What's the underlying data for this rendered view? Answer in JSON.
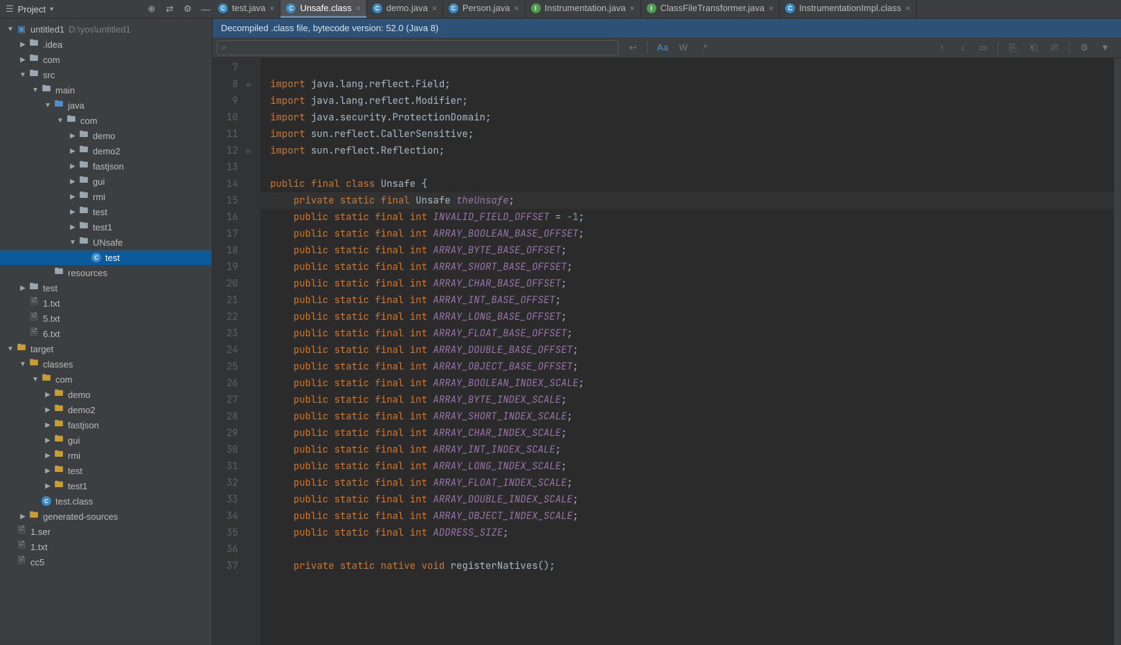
{
  "projectHeader": {
    "title": "Project",
    "dropdownGlyph": "▾",
    "tool1": "⊕",
    "tool2": "⇄",
    "tool3": "⚙",
    "tool4": "—"
  },
  "tabs": [
    {
      "icon": "C",
      "type": "c",
      "label": "test.java",
      "active": false
    },
    {
      "icon": "C",
      "type": "c",
      "label": "Unsafe.class",
      "active": true
    },
    {
      "icon": "C",
      "type": "c",
      "label": "demo.java",
      "active": false
    },
    {
      "icon": "C",
      "type": "c",
      "label": "Person.java",
      "active": false
    },
    {
      "icon": "I",
      "type": "i",
      "label": "Instrumentation.java",
      "active": false
    },
    {
      "icon": "I",
      "type": "i",
      "label": "ClassFileTransformer.java",
      "active": false
    },
    {
      "icon": "C",
      "type": "c",
      "label": "InstrumentationImpl.class",
      "active": false
    }
  ],
  "tree": [
    {
      "indent": 0,
      "arrow": "▼",
      "iconClass": "module-icon",
      "iconGlyph": "▣",
      "label": "untitled1",
      "dim": "D:\\yos\\untitled1"
    },
    {
      "indent": 1,
      "arrow": "▶",
      "iconClass": "folder-icon",
      "iconGlyph": "🖿",
      "label": ".idea"
    },
    {
      "indent": 1,
      "arrow": "▶",
      "iconClass": "folder-icon",
      "iconGlyph": "🖿",
      "label": "com"
    },
    {
      "indent": 1,
      "arrow": "▼",
      "iconClass": "folder-icon",
      "iconGlyph": "🖿",
      "label": "src"
    },
    {
      "indent": 2,
      "arrow": "▼",
      "iconClass": "folder-icon",
      "iconGlyph": "🖿",
      "label": "main"
    },
    {
      "indent": 3,
      "arrow": "▼",
      "iconClass": "folder-blue",
      "iconGlyph": "🖿",
      "label": "java"
    },
    {
      "indent": 4,
      "arrow": "▼",
      "iconClass": "folder-icon",
      "iconGlyph": "🖿",
      "label": "com"
    },
    {
      "indent": 5,
      "arrow": "▶",
      "iconClass": "folder-icon",
      "iconGlyph": "🖿",
      "label": "demo"
    },
    {
      "indent": 5,
      "arrow": "▶",
      "iconClass": "folder-icon",
      "iconGlyph": "🖿",
      "label": "demo2"
    },
    {
      "indent": 5,
      "arrow": "▶",
      "iconClass": "folder-icon",
      "iconGlyph": "🖿",
      "label": "fastjson"
    },
    {
      "indent": 5,
      "arrow": "▶",
      "iconClass": "folder-icon",
      "iconGlyph": "🖿",
      "label": "gui"
    },
    {
      "indent": 5,
      "arrow": "▶",
      "iconClass": "folder-icon",
      "iconGlyph": "🖿",
      "label": "rmi"
    },
    {
      "indent": 5,
      "arrow": "▶",
      "iconClass": "folder-icon",
      "iconGlyph": "🖿",
      "label": "test"
    },
    {
      "indent": 5,
      "arrow": "▶",
      "iconClass": "folder-icon",
      "iconGlyph": "🖿",
      "label": "test1"
    },
    {
      "indent": 5,
      "arrow": "▼",
      "iconClass": "folder-icon",
      "iconGlyph": "🖿",
      "label": "UNsafe"
    },
    {
      "indent": 6,
      "arrow": "",
      "iconType": "class",
      "iconGlyph": "C",
      "label": "test",
      "selected": true
    },
    {
      "indent": 3,
      "arrow": "",
      "iconClass": "folder-icon",
      "iconGlyph": "🖿",
      "label": "resources"
    },
    {
      "indent": 1,
      "arrow": "▶",
      "iconClass": "folder-icon",
      "iconGlyph": "🖿",
      "label": "test"
    },
    {
      "indent": 1,
      "arrow": "",
      "iconClass": "file-icon",
      "iconGlyph": "🗎",
      "label": "1.txt"
    },
    {
      "indent": 1,
      "arrow": "",
      "iconClass": "file-icon",
      "iconGlyph": "🗎",
      "label": "5.txt"
    },
    {
      "indent": 1,
      "arrow": "",
      "iconClass": "file-icon",
      "iconGlyph": "🗎",
      "label": "6.txt"
    },
    {
      "indent": 0,
      "arrow": "▼",
      "iconClass": "folder-gold",
      "iconGlyph": "🖿",
      "label": "target"
    },
    {
      "indent": 1,
      "arrow": "▼",
      "iconClass": "folder-gold",
      "iconGlyph": "🖿",
      "label": "classes"
    },
    {
      "indent": 2,
      "arrow": "▼",
      "iconClass": "folder-gold",
      "iconGlyph": "🖿",
      "label": "com"
    },
    {
      "indent": 3,
      "arrow": "▶",
      "iconClass": "folder-gold",
      "iconGlyph": "🖿",
      "label": "demo"
    },
    {
      "indent": 3,
      "arrow": "▶",
      "iconClass": "folder-gold",
      "iconGlyph": "🖿",
      "label": "demo2"
    },
    {
      "indent": 3,
      "arrow": "▶",
      "iconClass": "folder-gold",
      "iconGlyph": "🖿",
      "label": "fastjson"
    },
    {
      "indent": 3,
      "arrow": "▶",
      "iconClass": "folder-gold",
      "iconGlyph": "🖿",
      "label": "gui"
    },
    {
      "indent": 3,
      "arrow": "▶",
      "iconClass": "folder-gold",
      "iconGlyph": "🖿",
      "label": "rmi"
    },
    {
      "indent": 3,
      "arrow": "▶",
      "iconClass": "folder-gold",
      "iconGlyph": "🖿",
      "label": "test"
    },
    {
      "indent": 3,
      "arrow": "▶",
      "iconClass": "folder-gold",
      "iconGlyph": "🖿",
      "label": "test1"
    },
    {
      "indent": 2,
      "arrow": "",
      "iconType": "class",
      "iconGlyph": "C",
      "label": "test.class"
    },
    {
      "indent": 1,
      "arrow": "▶",
      "iconClass": "folder-gold",
      "iconGlyph": "🖿",
      "label": "generated-sources"
    },
    {
      "indent": 0,
      "arrow": "",
      "iconClass": "file-icon",
      "iconGlyph": "🗎",
      "label": "1.ser"
    },
    {
      "indent": 0,
      "arrow": "",
      "iconClass": "file-icon",
      "iconGlyph": "🗎",
      "label": "1.txt"
    },
    {
      "indent": 0,
      "arrow": "",
      "iconClass": "file-icon",
      "iconGlyph": "🗎",
      "label": "cc5"
    }
  ],
  "banner": "Decompiled .class file, bytecode version: 52.0 (Java 8)",
  "findBar": {
    "searchGlyph": "⌕",
    "placeholder": "",
    "icons": {
      "prev": "↩",
      "matchCase": "Aa",
      "word": "W",
      "regex": ".*",
      "up": "↑",
      "down": "↓",
      "select": "▭",
      "addSel": "⎘",
      "selAll": "⎗",
      "remSel": "⎚",
      "settings": "⚙",
      "filter": "▼"
    }
  },
  "code": {
    "startLine": 7,
    "lines": [
      {
        "raw": ""
      },
      {
        "fold": "⊖",
        "tokens": [
          [
            "kw",
            "import "
          ],
          [
            "ident",
            "java.lang.reflect.Field"
          ],
          [
            "ident",
            ";"
          ]
        ]
      },
      {
        "tokens": [
          [
            "kw",
            "import "
          ],
          [
            "ident",
            "java.lang.reflect.Modifier"
          ],
          [
            "ident",
            ";"
          ]
        ]
      },
      {
        "tokens": [
          [
            "kw",
            "import "
          ],
          [
            "ident",
            "java.security.ProtectionDomain"
          ],
          [
            "ident",
            ";"
          ]
        ]
      },
      {
        "tokens": [
          [
            "kw",
            "import "
          ],
          [
            "ident",
            "sun.reflect.CallerSensitive"
          ],
          [
            "ident",
            ";"
          ]
        ]
      },
      {
        "fold": "⊟",
        "tokens": [
          [
            "kw",
            "import "
          ],
          [
            "ident",
            "sun.reflect.Reflection"
          ],
          [
            "ident",
            ";"
          ]
        ]
      },
      {
        "raw": ""
      },
      {
        "tokens": [
          [
            "kw",
            "public final class "
          ],
          [
            "ident",
            "Unsafe {"
          ]
        ]
      },
      {
        "current": true,
        "tokens": [
          [
            "pad",
            "    "
          ],
          [
            "kw",
            "private static final "
          ],
          [
            "ident",
            "Unsafe "
          ],
          [
            "field",
            "theUnsafe"
          ],
          [
            "ident",
            ";"
          ]
        ]
      },
      {
        "tokens": [
          [
            "pad",
            "    "
          ],
          [
            "kw",
            "public static final int "
          ],
          [
            "field",
            "INVALID_FIELD_OFFSET"
          ],
          [
            "ident",
            " = "
          ],
          [
            "num",
            "-1"
          ],
          [
            "ident",
            ";"
          ]
        ]
      },
      {
        "tokens": [
          [
            "pad",
            "    "
          ],
          [
            "kw",
            "public static final int "
          ],
          [
            "field",
            "ARRAY_BOOLEAN_BASE_OFFSET"
          ],
          [
            "ident",
            ";"
          ]
        ]
      },
      {
        "tokens": [
          [
            "pad",
            "    "
          ],
          [
            "kw",
            "public static final int "
          ],
          [
            "field",
            "ARRAY_BYTE_BASE_OFFSET"
          ],
          [
            "ident",
            ";"
          ]
        ]
      },
      {
        "tokens": [
          [
            "pad",
            "    "
          ],
          [
            "kw",
            "public static final int "
          ],
          [
            "field",
            "ARRAY_SHORT_BASE_OFFSET"
          ],
          [
            "ident",
            ";"
          ]
        ]
      },
      {
        "tokens": [
          [
            "pad",
            "    "
          ],
          [
            "kw",
            "public static final int "
          ],
          [
            "field",
            "ARRAY_CHAR_BASE_OFFSET"
          ],
          [
            "ident",
            ";"
          ]
        ]
      },
      {
        "tokens": [
          [
            "pad",
            "    "
          ],
          [
            "kw",
            "public static final int "
          ],
          [
            "field",
            "ARRAY_INT_BASE_OFFSET"
          ],
          [
            "ident",
            ";"
          ]
        ]
      },
      {
        "tokens": [
          [
            "pad",
            "    "
          ],
          [
            "kw",
            "public static final int "
          ],
          [
            "field",
            "ARRAY_LONG_BASE_OFFSET"
          ],
          [
            "ident",
            ";"
          ]
        ]
      },
      {
        "tokens": [
          [
            "pad",
            "    "
          ],
          [
            "kw",
            "public static final int "
          ],
          [
            "field",
            "ARRAY_FLOAT_BASE_OFFSET"
          ],
          [
            "ident",
            ";"
          ]
        ]
      },
      {
        "tokens": [
          [
            "pad",
            "    "
          ],
          [
            "kw",
            "public static final int "
          ],
          [
            "field",
            "ARRAY_DOUBLE_BASE_OFFSET"
          ],
          [
            "ident",
            ";"
          ]
        ]
      },
      {
        "tokens": [
          [
            "pad",
            "    "
          ],
          [
            "kw",
            "public static final int "
          ],
          [
            "field",
            "ARRAY_OBJECT_BASE_OFFSET"
          ],
          [
            "ident",
            ";"
          ]
        ]
      },
      {
        "tokens": [
          [
            "pad",
            "    "
          ],
          [
            "kw",
            "public static final int "
          ],
          [
            "field",
            "ARRAY_BOOLEAN_INDEX_SCALE"
          ],
          [
            "ident",
            ";"
          ]
        ]
      },
      {
        "tokens": [
          [
            "pad",
            "    "
          ],
          [
            "kw",
            "public static final int "
          ],
          [
            "field",
            "ARRAY_BYTE_INDEX_SCALE"
          ],
          [
            "ident",
            ";"
          ]
        ]
      },
      {
        "tokens": [
          [
            "pad",
            "    "
          ],
          [
            "kw",
            "public static final int "
          ],
          [
            "field",
            "ARRAY_SHORT_INDEX_SCALE"
          ],
          [
            "ident",
            ";"
          ]
        ]
      },
      {
        "tokens": [
          [
            "pad",
            "    "
          ],
          [
            "kw",
            "public static final int "
          ],
          [
            "field",
            "ARRAY_CHAR_INDEX_SCALE"
          ],
          [
            "ident",
            ";"
          ]
        ]
      },
      {
        "tokens": [
          [
            "pad",
            "    "
          ],
          [
            "kw",
            "public static final int "
          ],
          [
            "field",
            "ARRAY_INT_INDEX_SCALE"
          ],
          [
            "ident",
            ";"
          ]
        ]
      },
      {
        "tokens": [
          [
            "pad",
            "    "
          ],
          [
            "kw",
            "public static final int "
          ],
          [
            "field",
            "ARRAY_LONG_INDEX_SCALE"
          ],
          [
            "ident",
            ";"
          ]
        ]
      },
      {
        "tokens": [
          [
            "pad",
            "    "
          ],
          [
            "kw",
            "public static final int "
          ],
          [
            "field",
            "ARRAY_FLOAT_INDEX_SCALE"
          ],
          [
            "ident",
            ";"
          ]
        ]
      },
      {
        "tokens": [
          [
            "pad",
            "    "
          ],
          [
            "kw",
            "public static final int "
          ],
          [
            "field",
            "ARRAY_DOUBLE_INDEX_SCALE"
          ],
          [
            "ident",
            ";"
          ]
        ]
      },
      {
        "tokens": [
          [
            "pad",
            "    "
          ],
          [
            "kw",
            "public static final int "
          ],
          [
            "field",
            "ARRAY_OBJECT_INDEX_SCALE"
          ],
          [
            "ident",
            ";"
          ]
        ]
      },
      {
        "tokens": [
          [
            "pad",
            "    "
          ],
          [
            "kw",
            "public static final int "
          ],
          [
            "field",
            "ADDRESS_SIZE"
          ],
          [
            "ident",
            ";"
          ]
        ]
      },
      {
        "raw": ""
      },
      {
        "tokens": [
          [
            "pad",
            "    "
          ],
          [
            "kw",
            "private static native void "
          ],
          [
            "ident",
            "registerNatives();"
          ]
        ]
      }
    ]
  }
}
